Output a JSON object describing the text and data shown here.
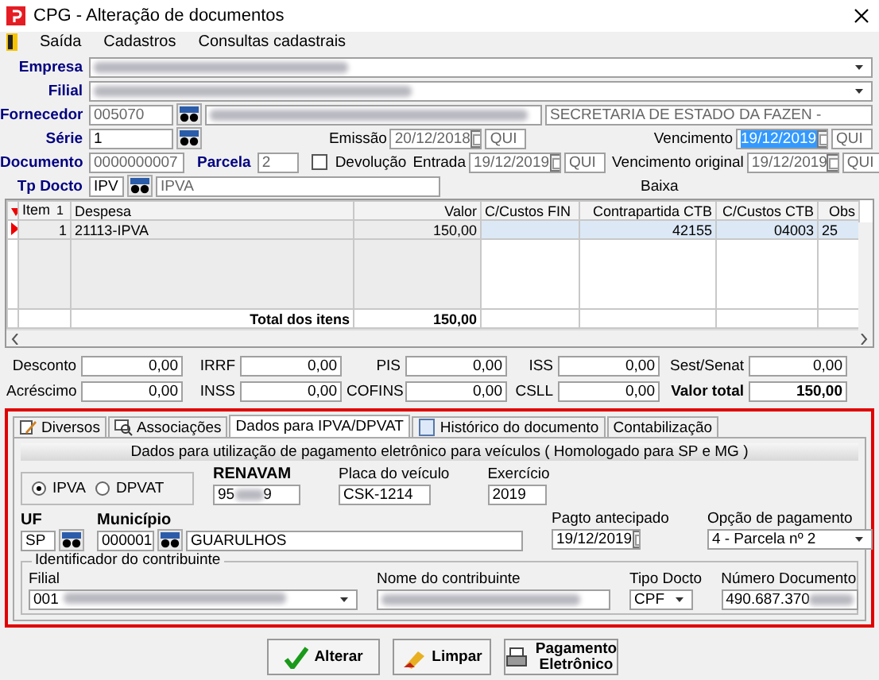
{
  "window": {
    "title": "CPG - Alteração de documentos"
  },
  "menu": [
    {
      "label": "Saída"
    },
    {
      "label": "Cadastros"
    },
    {
      "label": "Consultas cadastrais"
    }
  ],
  "header": {
    "empresa": {
      "label": "Empresa"
    },
    "filial": {
      "label": "Filial"
    },
    "fornecedor": {
      "label": "Fornecedor",
      "code": "005070",
      "name": "SECRETARIA DE ESTADO DA FAZEN -"
    },
    "serie": {
      "label": "Série",
      "value": "1"
    },
    "documento": {
      "label": "Documento",
      "value": "0000000007"
    },
    "parcela": {
      "label": "Parcela",
      "value": "2"
    },
    "devolucao": {
      "label": "Devolução",
      "checked": false
    },
    "emissao": {
      "label": "Emissão",
      "date": "20/12/2018",
      "weekday": "QUI",
      "selected": false
    },
    "entrada": {
      "label": "Entrada",
      "date": "19/12/2019",
      "weekday": "QUI",
      "selected": false
    },
    "vencimento": {
      "label": "Vencimento",
      "date": "19/12/2019",
      "weekday": "QUI",
      "selected": true
    },
    "vencimento_original": {
      "label": "Vencimento original",
      "date": "19/12/2019",
      "weekday": "QUI",
      "selected": false
    },
    "tp_docto": {
      "label": "Tp Docto",
      "code": "IPV",
      "name": "IPVA"
    },
    "baixa": "Baixa"
  },
  "grid": {
    "columns": [
      {
        "label": "Item",
        "sort_mark": "1"
      },
      {
        "label": "Despesa"
      },
      {
        "label": "Valor"
      },
      {
        "label": "C/Custos FIN"
      },
      {
        "label": "Contrapartida CTB"
      },
      {
        "label": "C/Custos CTB"
      },
      {
        "label": "Obs"
      }
    ],
    "rows": [
      {
        "selected": true,
        "cells": [
          "1",
          "21113-IPVA",
          "150,00",
          "",
          "42155",
          "04003",
          "25"
        ]
      }
    ],
    "total_label": "Total dos itens",
    "total_value": "150,00"
  },
  "totals": [
    [
      {
        "label": "Desconto",
        "value": "0,00",
        "kind": "plain"
      },
      {
        "label": "IRRF",
        "value": "0,00",
        "kind": "plain"
      },
      {
        "label": "PIS",
        "value": "0,00",
        "kind": "plain"
      },
      {
        "label": "ISS",
        "value": "0,00",
        "kind": "plain"
      },
      {
        "label": "Sest/Senat",
        "value": "0,00",
        "kind": "plain"
      }
    ],
    [
      {
        "label": "Acréscimo",
        "value": "0,00",
        "kind": "plain"
      },
      {
        "label": "INSS",
        "value": "0,00",
        "kind": "plain"
      },
      {
        "label": "COFINS",
        "value": "0,00",
        "kind": "plain"
      },
      {
        "label": "CSLL",
        "value": "0,00",
        "kind": "plain"
      },
      {
        "label": "Valor total",
        "value": "150,00",
        "kind": "total"
      }
    ]
  ],
  "tabs": [
    {
      "label": "Diversos",
      "selected": false
    },
    {
      "label": "Associações",
      "selected": false
    },
    {
      "label": "Dados para IPVA/DPVAT",
      "selected": true
    },
    {
      "label": "Histórico do documento",
      "selected": false
    },
    {
      "label": "Contabilização",
      "selected": false
    }
  ],
  "ipva_panel": {
    "title": "Dados para utilização de pagamento eletrônico para veículos ( Homologado para  SP e MG )",
    "modes": [
      {
        "label": "IPVA",
        "selected": true
      },
      {
        "label": "DPVAT",
        "selected": false
      }
    ],
    "renavam": {
      "label": "RENAVAM",
      "value_start": "95",
      "value_end": "9"
    },
    "placa": {
      "label": "Placa do veículo",
      "value": "CSK-1214"
    },
    "exercicio": {
      "label": "Exercício",
      "value": "2019"
    },
    "uf": {
      "label": "UF",
      "value": "SP"
    },
    "municipio": {
      "label": "Município",
      "code": "000001",
      "name": "GUARULHOS"
    },
    "pagto": {
      "label": "Pagto antecipado",
      "date": "19/12/2019"
    },
    "opcao": {
      "label": "Opção de pagamento",
      "value": "4 - Parcela nº 2"
    },
    "contribuinte": {
      "title": "Identificador do contribuinte",
      "filial": {
        "label": "Filial",
        "value": "001"
      },
      "nome": {
        "label": "Nome do contribuinte"
      },
      "tipo": {
        "label": "Tipo Docto",
        "value": "CPF"
      },
      "numero": {
        "label": "Número Documento",
        "value": "490.687.370"
      }
    }
  },
  "buttons": [
    {
      "label": "Alterar",
      "kind": "check"
    },
    {
      "label": "Limpar",
      "kind": "eraser"
    },
    {
      "label": "Pagamento Eletrônico",
      "kind": "printer"
    }
  ]
}
